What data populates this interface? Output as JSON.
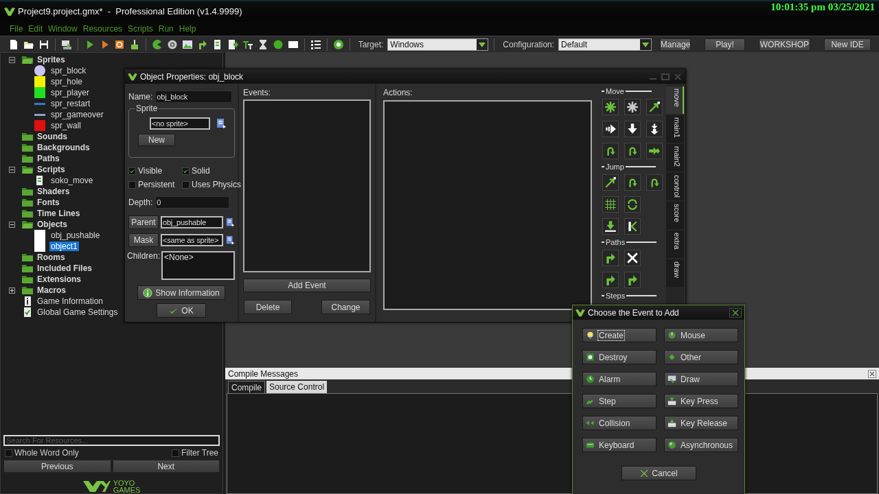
{
  "window": {
    "title": "Project9.project.gmx*  -  Professional Edition (v1.4.9999)",
    "clock": "10:01:35 pm 03/25/2021"
  },
  "menu": [
    "File",
    "Edit",
    "Window",
    "Resources",
    "Scripts",
    "Run",
    "Help"
  ],
  "toolbar": {
    "target_label": "Target:",
    "target_value": "Windows",
    "config_label": "Configuration:",
    "config_value": "Default",
    "buttons": [
      "Manage",
      "Play!",
      "WORKSHOP",
      "New IDE"
    ]
  },
  "resource_tree": [
    {
      "label": "Sprites",
      "kind": "folder",
      "expanded": true,
      "selected": false,
      "children": [
        {
          "label": "spr_block",
          "kind": "ball",
          "color": "#c8c4f4",
          "selected": false
        },
        {
          "label": "spr_hole",
          "kind": "block",
          "color": "#f4f000",
          "selected": false
        },
        {
          "label": "spr_player",
          "kind": "block",
          "color": "#22e022",
          "selected": false
        },
        {
          "label": "spr_restart",
          "kind": "bar",
          "color": "#3a78c8",
          "selected": false
        },
        {
          "label": "spr_gameover",
          "kind": "bar",
          "color": "#8aa0c8",
          "selected": false
        },
        {
          "label": "spr_wall",
          "kind": "block",
          "color": "#e01010",
          "selected": false
        }
      ]
    },
    {
      "label": "Sounds",
      "kind": "folder",
      "selected": false
    },
    {
      "label": "Backgrounds",
      "kind": "folder",
      "selected": false
    },
    {
      "label": "Paths",
      "kind": "folder",
      "selected": false
    },
    {
      "label": "Scripts",
      "kind": "folder",
      "expanded": true,
      "selected": false,
      "children": [
        {
          "label": "soko_move",
          "kind": "script",
          "selected": false
        }
      ]
    },
    {
      "label": "Shaders",
      "kind": "folder",
      "selected": false
    },
    {
      "label": "Fonts",
      "kind": "folder",
      "selected": false
    },
    {
      "label": "Time Lines",
      "kind": "folder",
      "selected": false
    },
    {
      "label": "Objects",
      "kind": "folder",
      "expanded": true,
      "selected": false,
      "children": [
        {
          "label": "obj_pushable",
          "kind": "object",
          "selected": false
        },
        {
          "label": "object1",
          "kind": "object",
          "selected": true
        }
      ]
    },
    {
      "label": "Rooms",
      "kind": "folder",
      "selected": false
    },
    {
      "label": "Included Files",
      "kind": "folder",
      "selected": false
    },
    {
      "label": "Extensions",
      "kind": "folder",
      "selected": false
    },
    {
      "label": "Macros",
      "kind": "folder",
      "expanded": false,
      "selected": false
    },
    {
      "label": "Game Information",
      "kind": "info",
      "selected": false
    },
    {
      "label": "Global Game Settings",
      "kind": "settings",
      "selected": false
    }
  ],
  "search": {
    "placeholder": "Search For Resources...",
    "options": [
      {
        "label": "Whole Word Only",
        "checked": false
      },
      {
        "label": "Filter Tree",
        "checked": false
      }
    ],
    "buttons": [
      "Previous",
      "Next"
    ]
  },
  "logo": {
    "line_1": "YOYO",
    "line_2": "GAMES"
  },
  "object_window": {
    "title": "Object Properties: obj_block",
    "name_label": "Name:",
    "name_value": "obj_block",
    "sprite_group": "Sprite",
    "sprite_value": "<no sprite>",
    "new_button": "New",
    "flags": [
      {
        "label": "Visible",
        "checked": true
      },
      {
        "label": "Solid",
        "checked": true
      },
      {
        "label": "Persistent",
        "checked": false
      },
      {
        "label": "Uses Physics",
        "checked": false
      }
    ],
    "depth_label": "Depth:",
    "depth_value": "0",
    "parent_button": "Parent",
    "parent_value": "obj_pushable",
    "mask_button": "Mask",
    "mask_value": "<same as sprite>",
    "children_label": "Children:",
    "children_value": "<None>",
    "info_button": "Show Information",
    "ok_button": "OK",
    "events_label": "Events:",
    "add_event_button": "Add Event",
    "delete_button": "Delete",
    "change_button": "Change",
    "actions_label": "Actions:",
    "palette_sections": [
      "Move",
      "Jump",
      "Paths",
      "Steps"
    ],
    "palette_tabs": [
      {
        "label": "move",
        "selected": true
      },
      {
        "label": "main1",
        "selected": false
      },
      {
        "label": "main2",
        "selected": false
      },
      {
        "label": "control",
        "selected": false
      },
      {
        "label": "score",
        "selected": false
      },
      {
        "label": "extra",
        "selected": false
      },
      {
        "label": "draw",
        "selected": false
      }
    ]
  },
  "compile_panel": {
    "title": "Compile Messages",
    "tabs": [
      {
        "label": "Compile",
        "selected": true
      },
      {
        "label": "Source Control",
        "selected": false
      }
    ]
  },
  "event_dialog": {
    "title": "Choose the Event to Add",
    "events": [
      {
        "label": "Create",
        "selected": true
      },
      {
        "label": "Mouse",
        "selected": false
      },
      {
        "label": "Destroy",
        "selected": false
      },
      {
        "label": "Other",
        "selected": false
      },
      {
        "label": "Alarm",
        "selected": false
      },
      {
        "label": "Draw",
        "selected": false
      },
      {
        "label": "Step",
        "selected": false
      },
      {
        "label": "Key Press",
        "selected": false
      },
      {
        "label": "Collision",
        "selected": false
      },
      {
        "label": "Key Release",
        "selected": false
      },
      {
        "label": "Keyboard",
        "selected": false
      },
      {
        "label": "Asynchronous",
        "selected": false
      }
    ],
    "cancel": "Cancel"
  }
}
